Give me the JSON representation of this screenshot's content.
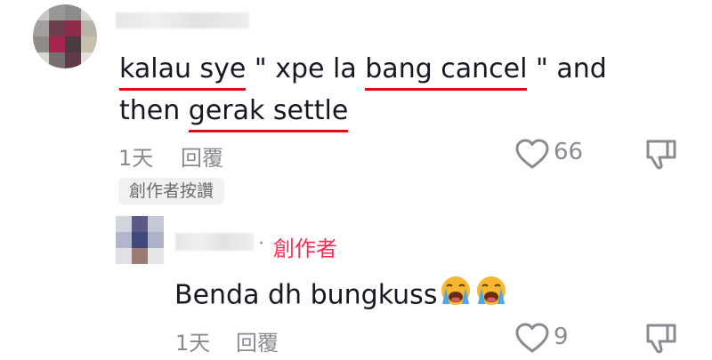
{
  "comment": {
    "segments": [
      {
        "text": "kalau sye",
        "underline": true
      },
      {
        "text": " \" xpe la ",
        "underline": false
      },
      {
        "text": "bang cancel",
        "underline": true
      },
      {
        "text": " \" and",
        "underline": false
      }
    ],
    "line2_segments": [
      {
        "text": "then ",
        "underline": false
      },
      {
        "text": "gerak settle",
        "underline": true
      }
    ],
    "time": "1天",
    "reply_label": "回覆",
    "like_count": "66",
    "creator_liked_badge": "創作者按讚"
  },
  "reply": {
    "separator": "·",
    "creator_tag": "創作者",
    "text": "Benda dh bungkuss",
    "emojis": [
      "loudly-crying-face",
      "loudly-crying-face"
    ],
    "time": "1天",
    "reply_label": "回覆",
    "like_count": "9"
  },
  "colors": {
    "underline": "#e50914",
    "creator_accent": "#fe2c55",
    "muted_text": "#8a8b91",
    "badge_bg": "#f1f1f2"
  }
}
